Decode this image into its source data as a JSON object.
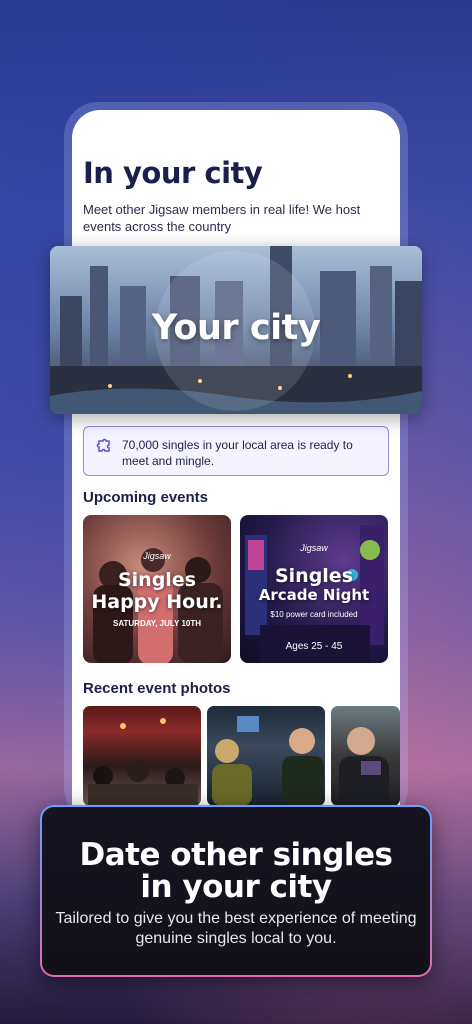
{
  "screen": {
    "title": "In your city",
    "subtitle": "Meet other Jigsaw members in real life! We host events across the country",
    "hero_label": "Your city",
    "info_text": "70,000 singles in your local area is ready to meet and mingle.",
    "info_icon": "jigsaw-piece-icon",
    "upcoming_title": "Upcoming events",
    "events": [
      {
        "brand": "Jigsaw",
        "title_line1": "Singles",
        "title_line2": "Happy Hour.",
        "detail": "SATURDAY, JULY 10TH"
      },
      {
        "brand": "Jigsaw",
        "title_line1": "Singles",
        "title_line2": "Arcade Night",
        "detail": "$10 power card included",
        "ages": "Ages 25 - 45"
      }
    ],
    "recent_title": "Recent event photos"
  },
  "promo": {
    "headline_line1": "Date other singles",
    "headline_line2": "in your city",
    "body": "Tailored to give you the best experience of meeting genuine singles local to you."
  },
  "colors": {
    "accent": "#5a55d6",
    "title_text": "#1c1f4a",
    "info_border": "#8f8fe0"
  }
}
